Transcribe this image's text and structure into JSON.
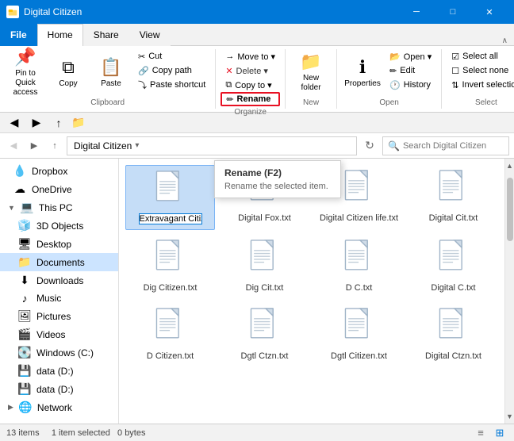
{
  "titleBar": {
    "title": "Digital Citizen",
    "icon": "📁",
    "minimize": "─",
    "maximize": "□",
    "close": "✕"
  },
  "ribbonTabs": {
    "file": "File",
    "home": "Home",
    "share": "Share",
    "view": "View"
  },
  "ribbon": {
    "clipboard": {
      "label": "Clipboard",
      "pinToQuick": "Pin to Quick\naccess",
      "copy": "Copy",
      "paste": "Paste",
      "cut": "Cut",
      "copyPath": "Copy path",
      "pasteShortcut": "Paste shortcut"
    },
    "organize": {
      "label": "Organize",
      "moveTo": "Move to ▾",
      "deleteTo": "Delete ▾",
      "copyTo": "Copy to ▾",
      "rename": "Rename"
    },
    "new": {
      "label": "New",
      "newFolder": "New\nfolder"
    },
    "open": {
      "label": "Open",
      "properties": "Properties",
      "open": "Open ▾",
      "edit": "Edit",
      "history": "History"
    },
    "select": {
      "label": "Select",
      "selectAll": "Select all",
      "selectNone": "Select none",
      "invertSelection": "Invert selection"
    }
  },
  "quickAccess": {
    "back": "←",
    "forward": "→",
    "up": "↑",
    "folder": "📁"
  },
  "addressBar": {
    "back": "←",
    "forward": "→",
    "up": "↑",
    "path": "Digital Citizen",
    "pathChevron": "▾",
    "refresh": "↻",
    "searchPlaceholder": "Search Digital Citizen"
  },
  "tooltip": {
    "title": "Rename (F2)",
    "description": "Rename the selected item."
  },
  "sidebar": {
    "items": [
      {
        "id": "dropbox",
        "label": "Dropbox",
        "icon": "💧",
        "indent": 1
      },
      {
        "id": "onedrive",
        "label": "OneDrive",
        "icon": "☁",
        "indent": 1
      },
      {
        "id": "thispc",
        "label": "This PC",
        "icon": "💻",
        "indent": 0
      },
      {
        "id": "3dobjects",
        "label": "3D Objects",
        "icon": "🧊",
        "indent": 1
      },
      {
        "id": "desktop",
        "label": "Desktop",
        "icon": "🖥",
        "indent": 1
      },
      {
        "id": "documents",
        "label": "Documents",
        "icon": "📁",
        "indent": 1,
        "active": true
      },
      {
        "id": "downloads",
        "label": "Downloads",
        "icon": "⬇",
        "indent": 1
      },
      {
        "id": "music",
        "label": "Music",
        "icon": "♪",
        "indent": 1
      },
      {
        "id": "pictures",
        "label": "Pictures",
        "icon": "🖼",
        "indent": 1
      },
      {
        "id": "videos",
        "label": "Videos",
        "icon": "🎬",
        "indent": 1
      },
      {
        "id": "windowsc",
        "label": "Windows (C:)",
        "icon": "💽",
        "indent": 1
      },
      {
        "id": "datad",
        "label": "data (D:)",
        "icon": "💽",
        "indent": 1
      },
      {
        "id": "datad2",
        "label": "data (D:)",
        "icon": "💽",
        "indent": 1
      },
      {
        "id": "network",
        "label": "Network",
        "icon": "🌐",
        "indent": 0
      }
    ]
  },
  "files": [
    {
      "id": "f1",
      "name": "Extravagant\nCitizen.txt",
      "selected": true,
      "rename": true
    },
    {
      "id": "f2",
      "name": "Digital Fox.txt"
    },
    {
      "id": "f3",
      "name": "Digital Citizen\nlife.txt"
    },
    {
      "id": "f4",
      "name": "Digital Cit.txt"
    },
    {
      "id": "f5",
      "name": "Dig Citizen.txt"
    },
    {
      "id": "f6",
      "name": "Dig Cit.txt"
    },
    {
      "id": "f7",
      "name": "D C.txt"
    },
    {
      "id": "f8",
      "name": "Digital C.txt"
    },
    {
      "id": "f9",
      "name": "D Citizen.txt"
    },
    {
      "id": "f10",
      "name": "Dgtl Ctzn.txt"
    },
    {
      "id": "f11",
      "name": "Dgtl Citizen.txt"
    },
    {
      "id": "f12",
      "name": "Digital Ctzn.txt"
    }
  ],
  "statusBar": {
    "itemCount": "13 items",
    "selected": "1 item selected",
    "size": "0 bytes"
  }
}
